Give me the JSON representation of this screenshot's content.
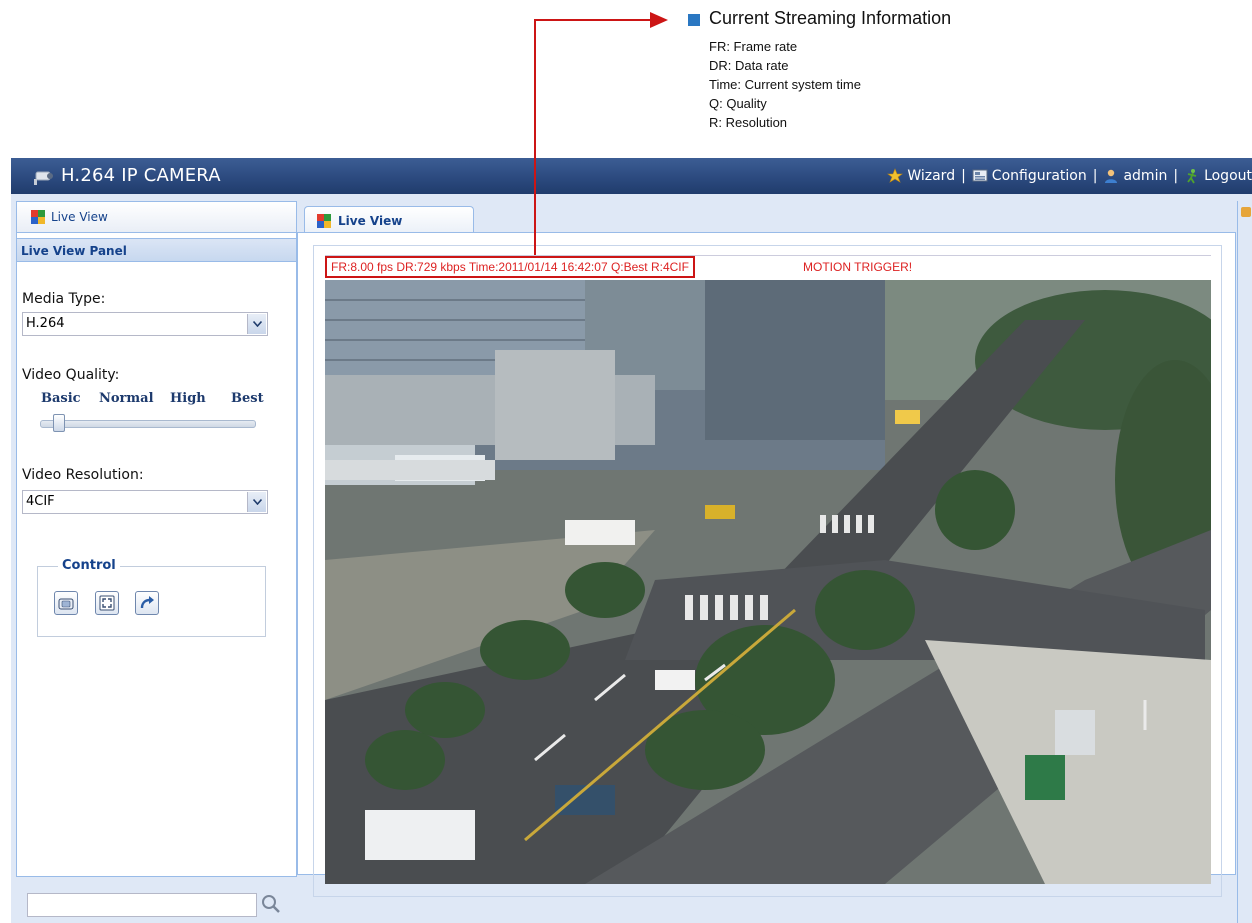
{
  "annotation": {
    "title": "Current Streaming Information",
    "lines": [
      "FR: Frame rate",
      "DR: Data rate",
      "Time: Current system time",
      "Q: Quality",
      "R: Resolution"
    ]
  },
  "header": {
    "app_title": "H.264 IP CAMERA",
    "nav": {
      "wizard": "Wizard",
      "configuration": "Configuration",
      "admin": "admin",
      "logout": "Logout"
    },
    "separator": "|"
  },
  "sidebar": {
    "tab_label": "Live View",
    "panel_title": "Live View Panel",
    "media_type": {
      "label": "Media Type:",
      "value": "H.264"
    },
    "video_quality": {
      "label": "Video Quality:",
      "levels": [
        "Basic",
        "Normal",
        "High",
        "Best"
      ],
      "selected_level": 0
    },
    "video_resolution": {
      "label": "Video Resolution:",
      "value": "4CIF"
    },
    "control": {
      "legend": "Control",
      "buttons": [
        "snapshot-icon",
        "fullscreen-icon",
        "rotate-icon"
      ]
    },
    "search": {
      "value": ""
    }
  },
  "main": {
    "tab_label": "Live View",
    "stream_info": "FR:8.00 fps  DR:729 kbps Time:2011/01/14 16:42:07 Q:Best R:4CIF",
    "motion_alert": "MOTION TRIGGER!"
  },
  "colors": {
    "annotation_bullet": "#2a77c2",
    "arrow": "#cc1515",
    "header_bg": "#2c4a7f",
    "alert_text": "#dd2222"
  }
}
